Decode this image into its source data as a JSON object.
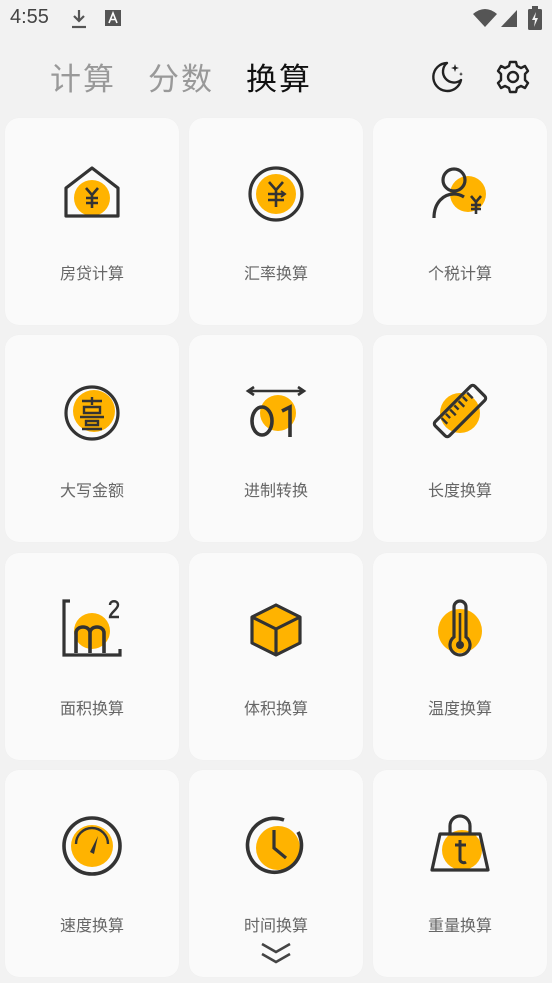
{
  "status_bar": {
    "time": "4:55"
  },
  "tabs": [
    {
      "label": "计算"
    },
    {
      "label": "分数"
    },
    {
      "label": "换算",
      "active": true
    }
  ],
  "colors": {
    "accent": "#FFB300",
    "stroke": "#333333",
    "card": "#FAFAFA",
    "background": "#F2F2F2"
  },
  "tools": [
    {
      "label": "房贷计算",
      "icon": "house-yuan-icon"
    },
    {
      "label": "汇率换算",
      "icon": "exchange-yuan-icon"
    },
    {
      "label": "个税计算",
      "icon": "person-yuan-icon"
    },
    {
      "label": "大写金额",
      "icon": "chinese-numeral-icon"
    },
    {
      "label": "进制转换",
      "icon": "binary-icon"
    },
    {
      "label": "长度换算",
      "icon": "ruler-icon"
    },
    {
      "label": "面积换算",
      "icon": "square-meter-icon"
    },
    {
      "label": "体积换算",
      "icon": "cube-icon"
    },
    {
      "label": "温度换算",
      "icon": "thermometer-icon"
    },
    {
      "label": "速度换算",
      "icon": "speedometer-icon"
    },
    {
      "label": "时间换算",
      "icon": "clock-icon"
    },
    {
      "label": "重量换算",
      "icon": "weight-icon"
    }
  ]
}
